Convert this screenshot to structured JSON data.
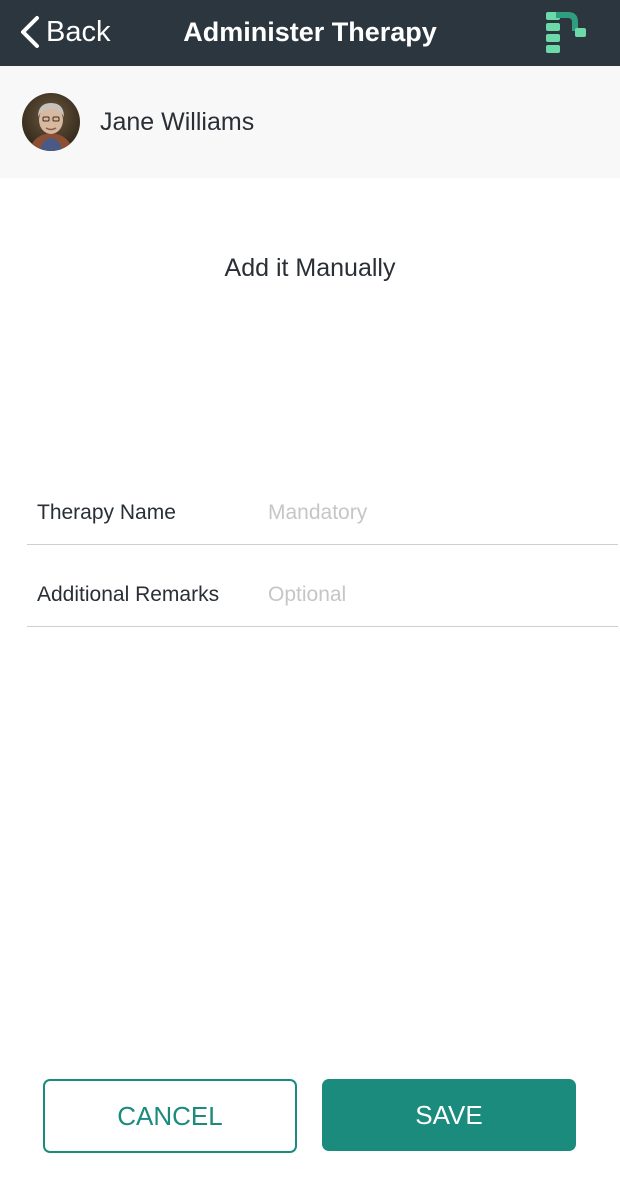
{
  "nav": {
    "back_label": "Back",
    "title": "Administer Therapy",
    "logo_icon": "app-logo-icon"
  },
  "patient": {
    "name": "Jane Williams",
    "avatar_icon": "patient-avatar"
  },
  "section": {
    "heading": "Add it Manually"
  },
  "form": {
    "therapy_name": {
      "label": "Therapy Name",
      "placeholder": "Mandatory",
      "value": ""
    },
    "additional_remarks": {
      "label": "Additional Remarks",
      "placeholder": "Optional",
      "value": ""
    }
  },
  "actions": {
    "cancel_label": "CANCEL",
    "save_label": "SAVE"
  },
  "colors": {
    "navbar": "#2c363e",
    "accent": "#1b8b7d",
    "logo_green": "#6ed9a8",
    "patient_bar": "#f8f8f8"
  }
}
